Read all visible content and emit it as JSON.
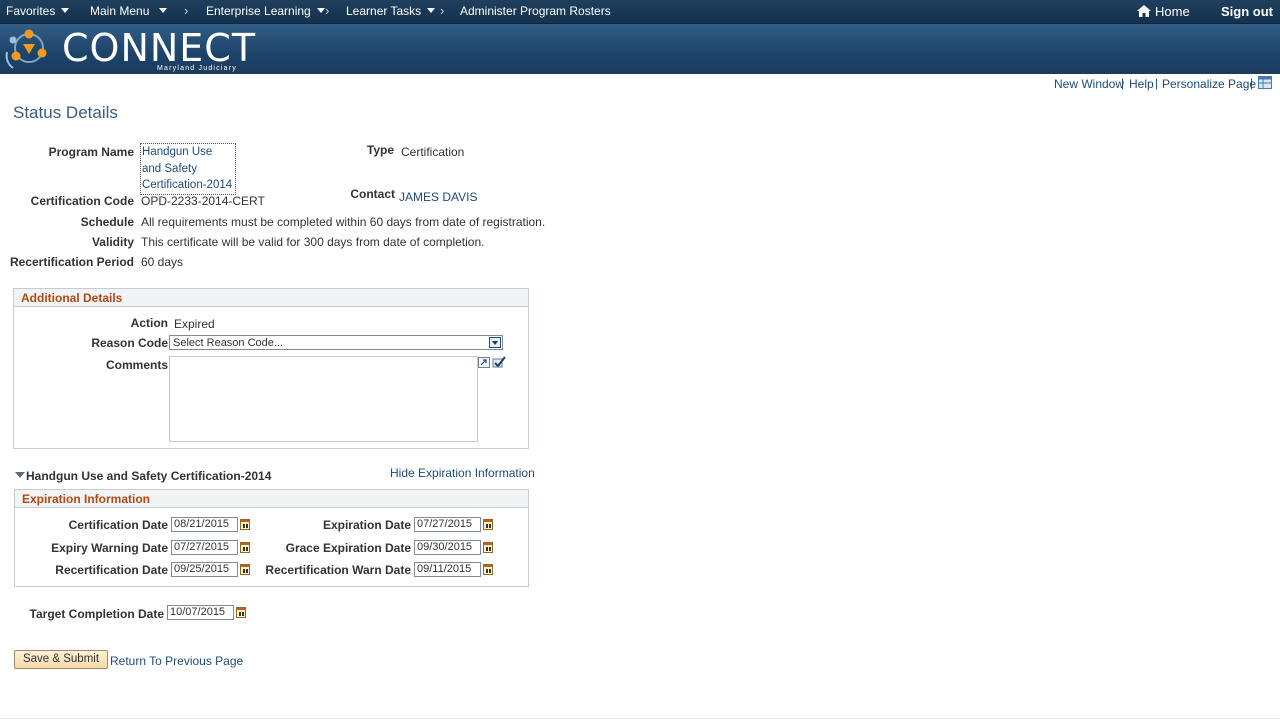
{
  "nav": {
    "favorites": "Favorites",
    "main_menu": "Main Menu",
    "enterprise_learning": "Enterprise Learning",
    "learner_tasks": "Learner Tasks",
    "current_page": "Administer Program Rosters",
    "home": "Home",
    "sign_out": "Sign out"
  },
  "banner": {
    "logo": "CONNECT",
    "logo_sub": "Maryland Judiciary"
  },
  "page_links": {
    "new_window": "New Window",
    "help": "Help",
    "personalize": "Personalize Page"
  },
  "page_title": "Status Details",
  "program": {
    "name_label": "Program Name",
    "name": "Handgun Use and Safety Certification-2014",
    "type_label": "Type",
    "type": "Certification",
    "code_label": "Certification Code",
    "code": "OPD-2233-2014-CERT",
    "contact_label": "Contact",
    "contact": "JAMES DAVIS",
    "schedule_label": "Schedule",
    "schedule": "All requirements must be completed within 60 days from date of registration.",
    "validity_label": "Validity",
    "validity": "This certificate will be valid for 300 days from date of completion.",
    "recert_label": "Recertification Period",
    "recert": "60 days"
  },
  "additional": {
    "title": "Additional Details",
    "action_label": "Action",
    "action": "Expired",
    "reason_label": "Reason Code",
    "reason_value": "Select Reason Code...",
    "comments_label": "Comments"
  },
  "expiration_section": {
    "program_title": "Handgun Use and Safety Certification-2014",
    "hide_link": "Hide Expiration Information",
    "title": "Expiration Information",
    "cert_date_label": "Certification Date",
    "cert_date": "08/21/2015",
    "exp_date_label": "Expiration Date",
    "exp_date": "07/27/2015",
    "warn_date_label": "Expiry Warning Date",
    "warn_date": "07/27/2015",
    "grace_label": "Grace Expiration Date",
    "grace_date": "09/30/2015",
    "recert_date_label": "Recertification Date",
    "recert_date": "09/25/2015",
    "recert_warn_label": "Recertification Warn Date",
    "recert_warn_date": "09/11/2015"
  },
  "target": {
    "label": "Target Completion Date",
    "date": "10/07/2015"
  },
  "actions": {
    "save": "Save & Submit",
    "return": "Return To Previous Page"
  }
}
